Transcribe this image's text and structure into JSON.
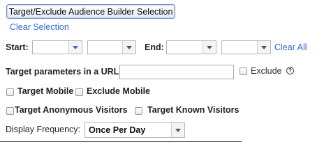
{
  "builder_button": "Target/Exclude Audience Builder Selection",
  "clear_selection": "Clear Selection",
  "date_range": {
    "start_label": "Start:",
    "end_label": "End:",
    "clear_all": "Clear All"
  },
  "url_params": {
    "label": "Target parameters in a URL:",
    "value": "",
    "exclude_label": "Exclude",
    "help_glyph": "?"
  },
  "mobile": {
    "target_label": "Target Mobile",
    "exclude_label": "Exclude Mobile"
  },
  "visitors": {
    "anonymous_label": "Target Anonymous Visitors",
    "known_label": "Target Known Visitors"
  },
  "display_frequency": {
    "label": "Display Frequency:",
    "selected": "Once Per Day"
  },
  "icons": {
    "dropdown": "chevron-down-icon",
    "help": "help-circle-icon"
  },
  "colors": {
    "link": "#2f6ad0",
    "dropdown_arrow": "#3a67c4"
  }
}
